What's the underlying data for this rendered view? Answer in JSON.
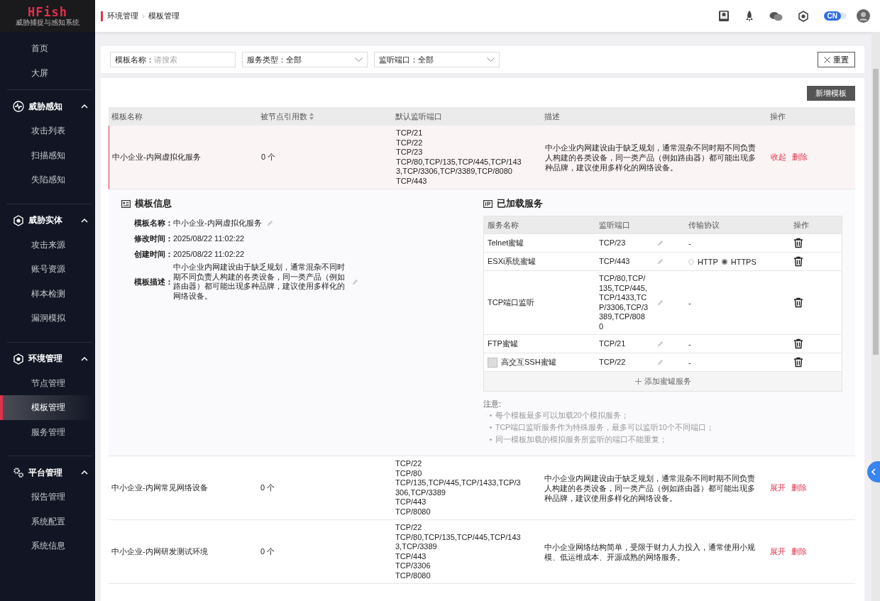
{
  "logo": {
    "title": "HFish",
    "subtitle": "威胁捕捉与感知系统"
  },
  "sidebar": {
    "items": [
      {
        "label": "首页",
        "selected": false
      },
      {
        "label": "大屏",
        "selected": false
      }
    ],
    "groups": [
      {
        "title": "威胁感知",
        "kind": "pulse",
        "expanded": true,
        "children": [
          {
            "label": "攻击列表",
            "selected": false
          },
          {
            "label": "扫描感知",
            "selected": false
          },
          {
            "label": "失陷感知",
            "selected": false
          }
        ]
      },
      {
        "title": "威胁实体",
        "kind": "hex",
        "expanded": true,
        "children": [
          {
            "label": "攻击来源",
            "selected": false
          },
          {
            "label": "账号资源",
            "selected": false
          },
          {
            "label": "样本检测",
            "selected": false
          },
          {
            "label": "漏洞模拟",
            "selected": false
          }
        ]
      },
      {
        "title": "环境管理",
        "kind": "hex",
        "expanded": true,
        "children": [
          {
            "label": "节点管理",
            "selected": false
          },
          {
            "label": "模板管理",
            "selected": true
          },
          {
            "label": "服务管理",
            "selected": false
          }
        ]
      },
      {
        "title": "平台管理",
        "kind": "gears",
        "expanded": true,
        "children": [
          {
            "label": "报告管理",
            "selected": false
          },
          {
            "label": "系统配置",
            "selected": false
          },
          {
            "label": "系统信息",
            "selected": false
          }
        ]
      }
    ]
  },
  "header": {
    "breadcrumb": [
      "环境管理",
      "模板管理"
    ],
    "language": "CN"
  },
  "filters": {
    "name": {
      "label": "模板名称：",
      "placeholder": "请搜索"
    },
    "selects": [
      {
        "label": "服务类型：",
        "value": "全部"
      },
      {
        "label": "监听端口：",
        "value": "全部"
      }
    ],
    "reset": "重置"
  },
  "add_button": "新增模板",
  "table": {
    "columns": [
      "模板名称",
      "被节点引用数",
      "默认监听端口",
      "描述",
      "操作"
    ],
    "rows": [
      {
        "name": "中小企业-内网虚拟化服务",
        "count": "0 个",
        "ports": [
          "TCP/21",
          "TCP/22",
          "TCP/23",
          "TCP/80,TCP/135,TCP/445,TCP/1433,TCP/3306,TCP/3389,TCP/8080",
          "TCP/443"
        ],
        "description": "中小企业内网建设由于缺乏规划，通常混杂不同时期不同负责人构建的各类设备，同一类产品（例如路由器）都可能出现多种品牌，建议使用多样化的网络设备。",
        "toggle": "收起",
        "delete": "删除",
        "expanded": true,
        "detail": {
          "info_title": "模板信息",
          "fields": [
            {
              "label": "模板名称：",
              "value": "中小企业-内网虚拟化服务",
              "editable": true
            },
            {
              "label": "修改时间：",
              "value": "2025/08/22 11:02:22",
              "editable": false
            },
            {
              "label": "创建时间：",
              "value": "2025/08/22 11:02:22",
              "editable": false
            },
            {
              "label": "模板描述：",
              "value": "中小企业内网建设由于缺乏规划，通常混杂不同时期不同负责人构建的各类设备，同一类产品（例如路由器）都可能出现多种品牌，建议使用多样化的网络设备。",
              "editable": true
            }
          ],
          "services_title": "已加载服务",
          "service_columns": [
            "服务名称",
            "监听端口",
            "传输协议",
            "操作"
          ],
          "services": [
            {
              "name": "Telnet蜜罐",
              "port": "TCP/23",
              "kind": "text",
              "protocol": "-",
              "thumbnail": false
            },
            {
              "name": "ESXi系统蜜罐",
              "port": "TCP/443",
              "kind": "choice",
              "options": [
                {
                  "label": "HTTP",
                  "selected": false
                },
                {
                  "label": "HTTPS",
                  "selected": true
                }
              ],
              "thumbnail": false
            },
            {
              "name": "TCP端口监听",
              "port": "TCP/80,TCP/135,TCP/445,TCP/1433,TCP/3306,TCP/3389,TCP/8080",
              "kind": "text",
              "protocol": "-",
              "thumbnail": false
            },
            {
              "name": "FTP蜜罐",
              "port": "TCP/21",
              "kind": "text",
              "protocol": "-",
              "thumbnail": false
            },
            {
              "name": "高交互SSH蜜罐",
              "port": "TCP/22",
              "kind": "text",
              "protocol": "-",
              "thumbnail": true
            }
          ],
          "add_service": "添加蜜罐服务",
          "notes_title": "注意:",
          "notes": [
            "每个模板最多可以加载20个模拟服务；",
            "TCP端口监听服务作为特殊服务，最多可以监听10个不同端口；",
            "同一模板加载的模拟服务所监听的端口不能重复；"
          ]
        }
      },
      {
        "name": "中小企业-内网常见网络设备",
        "count": "0 个",
        "ports": [
          "TCP/22",
          "TCP/80",
          "TCP/135,TCP/445,TCP/1433,TCP/3306,TCP/3389",
          "TCP/443",
          "TCP/8080"
        ],
        "description": "中小企业内网建设由于缺乏规划，通常混杂不同时期不同负责人构建的各类设备，同一类产品（例如路由器）都可能出现多种品牌，建议使用多样化的网络设备。",
        "toggle": "展开",
        "delete": "删除",
        "expanded": false
      },
      {
        "name": "中小企业-内网研发测试环境",
        "count": "0 个",
        "ports": [
          "TCP/22",
          "TCP/80,TCP/135,TCP/445,TCP/1433,TCP/3389",
          "TCP/443",
          "TCP/3306",
          "TCP/8080"
        ],
        "description": "中小企业网络结构简单，受限于财力人力投入，通常使用小规模、低运维成本、开源成熟的网络服务。",
        "toggle": "展开",
        "delete": "删除",
        "expanded": false
      }
    ]
  }
}
